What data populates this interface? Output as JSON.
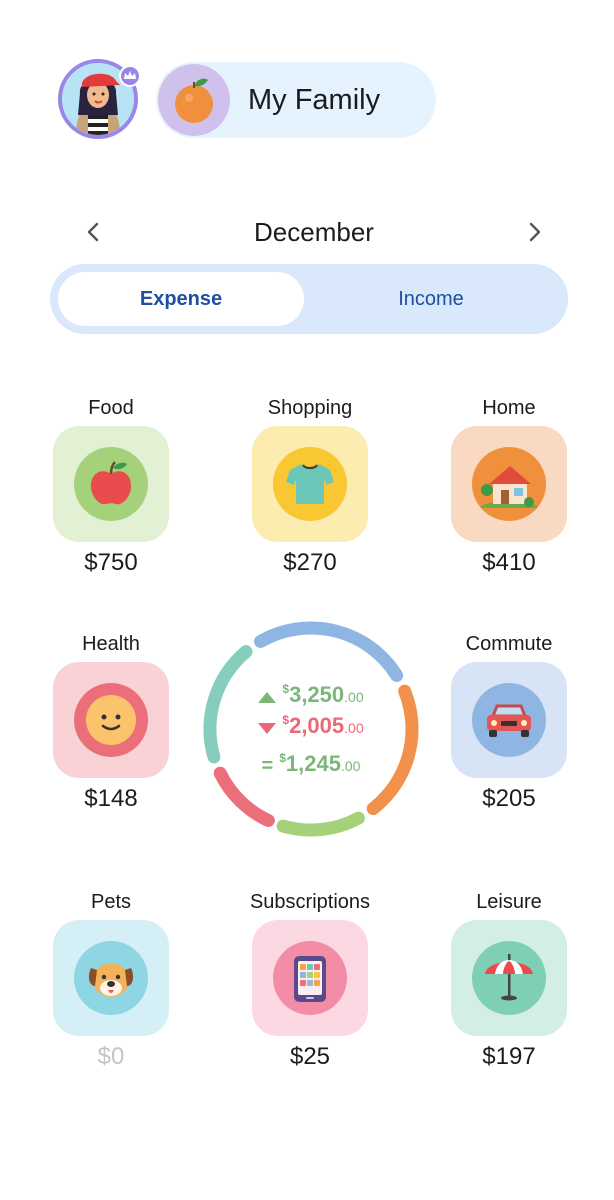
{
  "header": {
    "avatar_icon": "user-avatar-icon",
    "badge_icon": "crown-icon",
    "family": {
      "icon": "orange-fruit-icon",
      "name": "My Family"
    }
  },
  "month": {
    "prev_icon": "chevron-left-icon",
    "label": "December",
    "next_icon": "chevron-right-icon"
  },
  "tabs": {
    "expense": "Expense",
    "income": "Income",
    "selected": "Expense"
  },
  "categories": {
    "food": {
      "label": "Food",
      "amount": "$750",
      "icon": "apple-icon"
    },
    "shopping": {
      "label": "Shopping",
      "amount": "$270",
      "icon": "tshirt-icon"
    },
    "home": {
      "label": "Home",
      "amount": "$410",
      "icon": "house-icon"
    },
    "health": {
      "label": "Health",
      "amount": "$148",
      "icon": "smiley-face-icon"
    },
    "commute": {
      "label": "Commute",
      "amount": "$205",
      "icon": "car-icon"
    },
    "pets": {
      "label": "Pets",
      "amount": "$0",
      "icon": "dog-icon"
    },
    "subscriptions": {
      "label": "Subscriptions",
      "amount": "$25",
      "icon": "tablet-icon"
    },
    "leisure": {
      "label": "Leisure",
      "amount": "$197",
      "icon": "beach-umbrella-icon"
    }
  },
  "summary": {
    "currency": "$",
    "income": {
      "whole": "3,250",
      "cents": ".00"
    },
    "expense": {
      "whole": "2,005",
      "cents": ".00"
    },
    "net": {
      "sign": "=",
      "whole": "1,245",
      "cents": ".00"
    },
    "ring_colors": [
      "#ea6f7b",
      "#86cdbd",
      "#8fb6e3",
      "#f2914c",
      "#a5d17a"
    ]
  },
  "colors": {
    "accent": "#1f4fa0",
    "income_green": "#7cb678",
    "expense_red": "#e96a74",
    "zero_amount": "#c4c4c4"
  }
}
